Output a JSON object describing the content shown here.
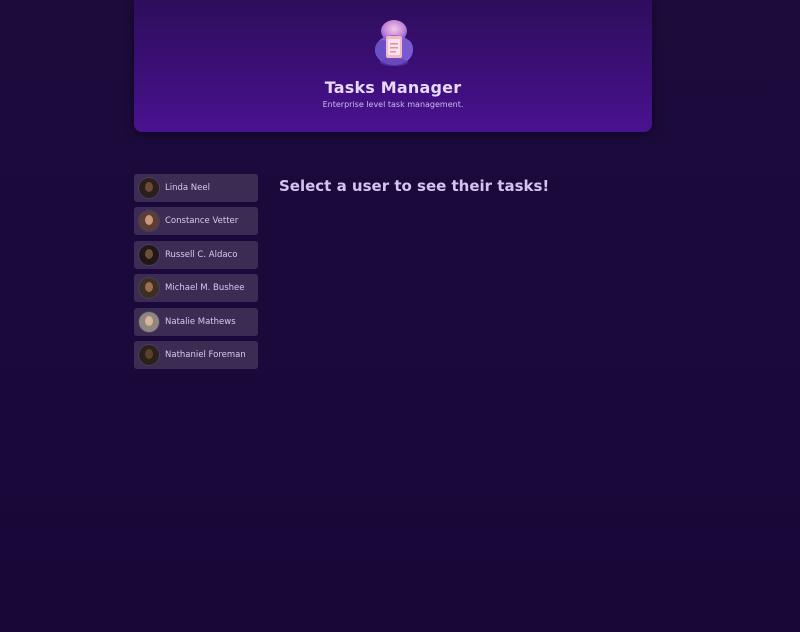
{
  "header": {
    "title": "Tasks Manager",
    "subtitle": "Enterprise level task management.",
    "logo_icon": "notebook-logo-icon"
  },
  "users": [
    {
      "name": "Linda Neel",
      "avatar_color": "#2a1f1a",
      "skin": "#6b4a36"
    },
    {
      "name": "Constance Vetter",
      "avatar_color": "#5b3e36",
      "skin": "#c9987e"
    },
    {
      "name": "Russell C. Aldaco",
      "avatar_color": "#1f1815",
      "skin": "#6e4d3a"
    },
    {
      "name": "Michael M. Bushee",
      "avatar_color": "#3d2f22",
      "skin": "#9a6e4e"
    },
    {
      "name": "Natalie Mathews",
      "avatar_color": "#8f8680",
      "skin": "#d8b59c"
    },
    {
      "name": "Nathaniel Foreman",
      "avatar_color": "#2b211b",
      "skin": "#5e3f2c"
    }
  ],
  "main": {
    "prompt": "Select a user to see their tasks!"
  },
  "colors": {
    "background": "#1a0a3c",
    "header": "#3c0f78",
    "user_card": "#3c2c54",
    "text": "#d9c9ef"
  }
}
